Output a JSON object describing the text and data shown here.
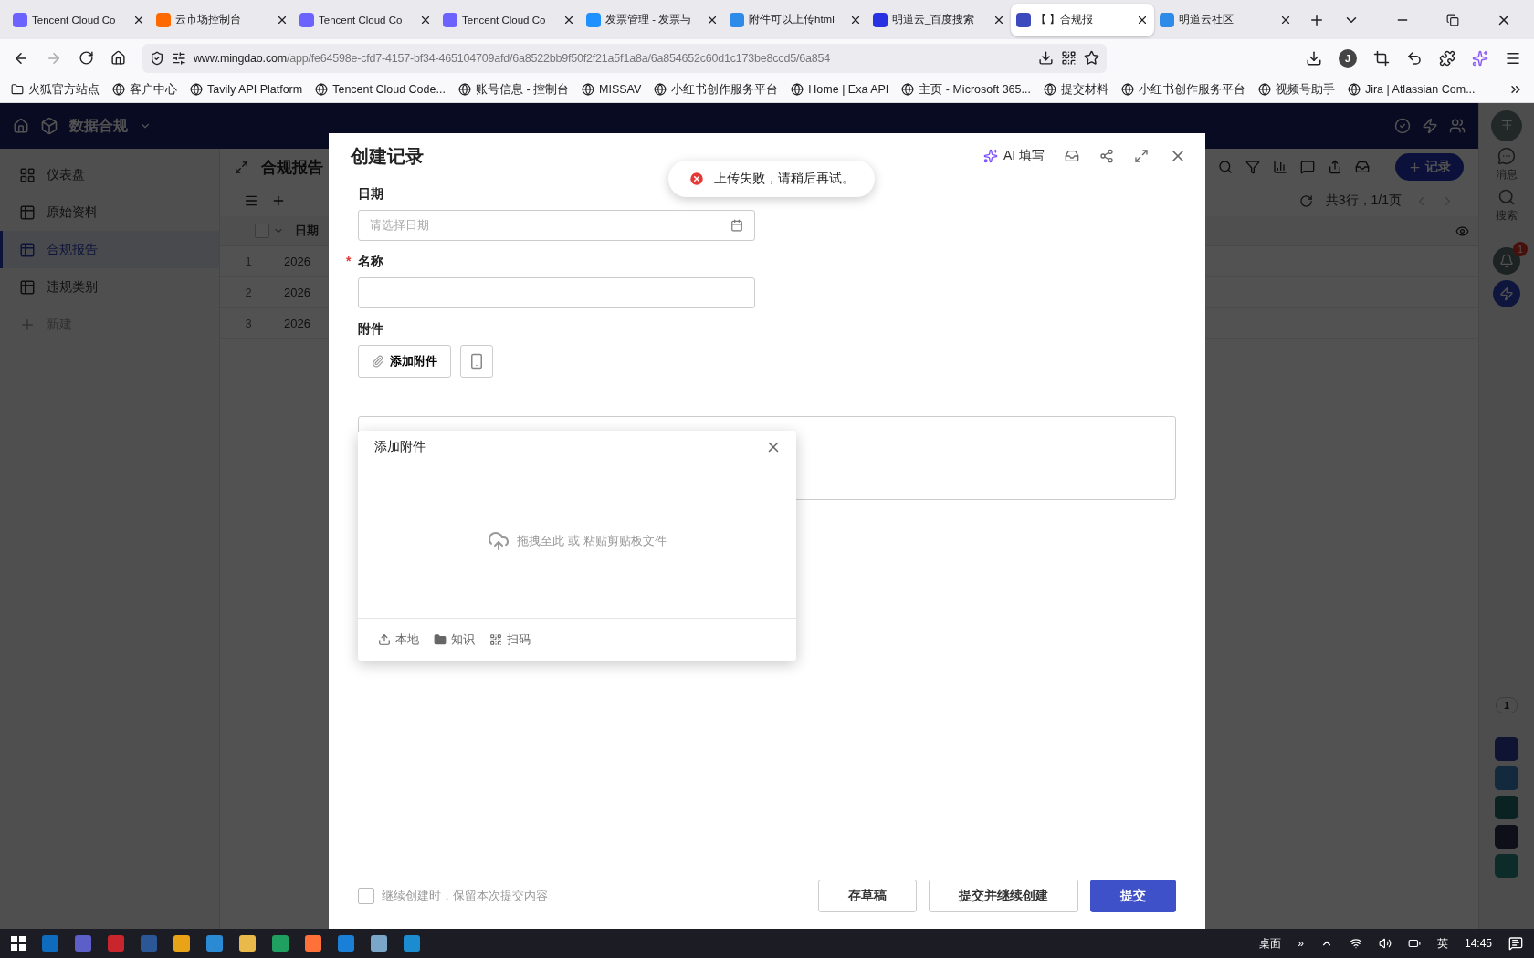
{
  "browser": {
    "tabs": [
      {
        "title": "Tencent Cloud Co",
        "selected": false
      },
      {
        "title": "云市场控制台",
        "selected": false
      },
      {
        "title": "Tencent Cloud Co",
        "selected": false
      },
      {
        "title": "Tencent Cloud Co",
        "selected": false
      },
      {
        "title": "发票管理 - 发票与",
        "selected": false
      },
      {
        "title": "附件可以上传html",
        "selected": false
      },
      {
        "title": "明道云_百度搜索",
        "selected": false
      },
      {
        "title": "【          】合规报",
        "selected": true
      },
      {
        "title": "明道云社区",
        "selected": false
      }
    ],
    "address": {
      "host": "www.mingdao.com",
      "path": "/app/fe64598e-cfd7-4157-bf34-465104709afd/6a8522bb9f50f2f21a5f1a8a/6a854652c60d1c173be8ccd5/6a854"
    },
    "profile_initial": "J",
    "bookmarks": [
      "火狐官方站点",
      "客户中心",
      "Tavily API Platform",
      "Tencent Cloud Code...",
      "账号信息 - 控制台",
      "MISSAV",
      "小红书创作服务平台",
      "Home | Exa API",
      "主页 - Microsoft 365...",
      "提交材料",
      "小红书创作服务平台",
      "视频号助手",
      "Jira | Atlassian Com..."
    ]
  },
  "app": {
    "name": "数据合规",
    "sidebar": [
      {
        "label": "仪表盘",
        "kind": "dashboard",
        "selected": false
      },
      {
        "label": "原始资料",
        "kind": "sheet",
        "selected": false
      },
      {
        "label": "合规报告",
        "kind": "sheet",
        "selected": true
      },
      {
        "label": "违规类别",
        "kind": "sheet",
        "selected": false
      },
      {
        "label": "新建",
        "kind": "add",
        "selected": false
      }
    ],
    "view_title": "合规报告",
    "add_record_button": "记录",
    "pagination": "共3行，1/1页",
    "table": {
      "select_all_checked": false,
      "columns": [
        "日期"
      ],
      "rows": [
        {
          "number": "1",
          "date": "2026"
        },
        {
          "number": "2",
          "date": "2026"
        },
        {
          "number": "3",
          "date": "2026"
        }
      ]
    }
  },
  "right_rail": {
    "avatar": "王",
    "items": [
      {
        "label": "消息",
        "kind": "message"
      },
      {
        "label": "搜索",
        "kind": "search"
      }
    ],
    "notification_badge": "1",
    "page_indicator": "1"
  },
  "dialog": {
    "title": "创建记录",
    "required_mark": "*",
    "ai_fill": "AI 填写",
    "toast": "上传失败，请稍后再试。",
    "fields": [
      {
        "label": "日期",
        "kind": "date",
        "required": false,
        "placeholder": "请选择日期"
      },
      {
        "label": "名称",
        "kind": "text",
        "required": true
      },
      {
        "label": "附件",
        "kind": "attachment",
        "required": false,
        "button": "添加附件"
      }
    ],
    "attachment_popup": {
      "title": "添加附件",
      "drop_hint": "拖拽至此 或 粘贴剪贴板文件",
      "sources": [
        {
          "label": "本地",
          "kind": "local"
        },
        {
          "label": "知识",
          "kind": "knowledge"
        },
        {
          "label": "扫码",
          "kind": "scan"
        }
      ]
    },
    "keep_content": {
      "label": "继续创建时，保留本次提交内容",
      "checked": false
    },
    "buttons": [
      {
        "label": "存草稿",
        "kind": "secondary"
      },
      {
        "label": "提交并继续创建",
        "kind": "secondary"
      },
      {
        "label": "提交",
        "kind": "primary"
      }
    ]
  },
  "taskbar": {
    "desktop_label": "桌面",
    "chevron": "»",
    "ime": "英",
    "time": "14:45"
  }
}
